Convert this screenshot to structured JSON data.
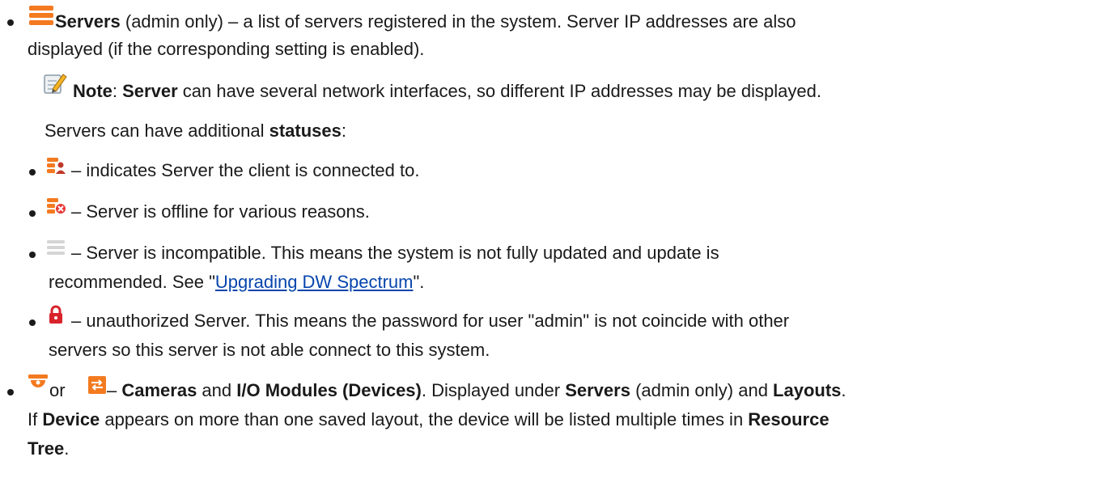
{
  "servers_item": {
    "icon": "server-icon",
    "title": "Servers",
    "rest": " (admin only) – a list of servers registered in the system. Server IP addresses are also",
    "line2": "displayed (if the corresponding setting is enabled)."
  },
  "note": {
    "icon": "note-pencil-icon",
    "label": "Note",
    "colon": ": ",
    "subject": "Server",
    "text": "  can have several network interfaces, so different IP addresses may be displayed."
  },
  "statuses_intro": {
    "text": "Servers can have additional ",
    "bold": "statuses",
    "colon": ":"
  },
  "statuses": [
    {
      "icon": "server-connected-icon",
      "text": "– indicates Server the client is connected to."
    },
    {
      "icon": "server-offline-icon",
      "text": "– Server is offline for various reasons."
    },
    {
      "icon": "server-incompatible-icon",
      "text": "– Server is incompatible. This means the system is not fully updated and update is",
      "line2_prefix": "recommended. See \"",
      "link": "Upgrading DW Spectrum",
      "line2_suffix": "\"."
    },
    {
      "icon": "lock-icon",
      "text": "– unauthorized Server. This means the password for user \"admin\" is not coincide with other",
      "line2": "servers so this server is not able connect to this system."
    }
  ],
  "devices_item": {
    "icon_camera": "camera-icon",
    "or": "or",
    "icon_io": "io-module-icon",
    "dash": " – ",
    "cameras": "Cameras",
    "and1": " and ",
    "io": "I/O Modules (Devices)",
    "t1": ". Displayed under ",
    "servers": "Servers",
    "t2": " (admin only) and ",
    "layouts": "Layouts",
    "t3": ".",
    "l2a": "If ",
    "device": "Device",
    "l2b": " appears on more than one saved layout, the device will be listed multiple times in ",
    "resource": "Resource",
    "tree": "Tree",
    "period": "."
  },
  "colors": {
    "accent_orange": "#f47a20",
    "link_blue": "#0645ad",
    "lock_red": "#d9232b"
  }
}
